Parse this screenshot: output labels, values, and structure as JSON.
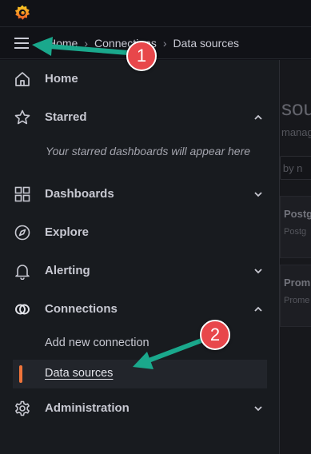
{
  "topbar": {
    "logo_icon": "grafana-logo-icon"
  },
  "breadcrumb": {
    "items": [
      "Home",
      "Connections",
      "Data sources"
    ]
  },
  "sidebar": {
    "items": [
      {
        "label": "Home",
        "icon": "home-icon"
      },
      {
        "label": "Starred",
        "icon": "star-icon",
        "expanded": true
      },
      {
        "label": "Dashboards",
        "icon": "dashboards-grid-icon",
        "expanded": false
      },
      {
        "label": "Explore",
        "icon": "compass-icon"
      },
      {
        "label": "Alerting",
        "icon": "bell-icon",
        "expanded": false
      },
      {
        "label": "Connections",
        "icon": "connections-icon",
        "expanded": true
      },
      {
        "label": "Administration",
        "icon": "gear-icon",
        "expanded": false
      }
    ],
    "starred_empty": "Your starred dashboards will appear here",
    "connections_children": [
      {
        "label": "Add new connection",
        "active": false
      },
      {
        "label": "Data sources",
        "active": true
      }
    ]
  },
  "background_page": {
    "title_fragment": "sou",
    "subtitle_fragment": "manag",
    "search_fragment": "h by n",
    "cards": [
      {
        "name": "Postg",
        "sub": "Postg"
      },
      {
        "name": "Prom",
        "sub": "Prome"
      }
    ]
  },
  "annotations": [
    {
      "number": "1"
    },
    {
      "number": "2"
    }
  ],
  "colors": {
    "accent": "#f0743a",
    "annotation_arrow": "#1aa88c",
    "annotation_badge": "#e8474b"
  }
}
